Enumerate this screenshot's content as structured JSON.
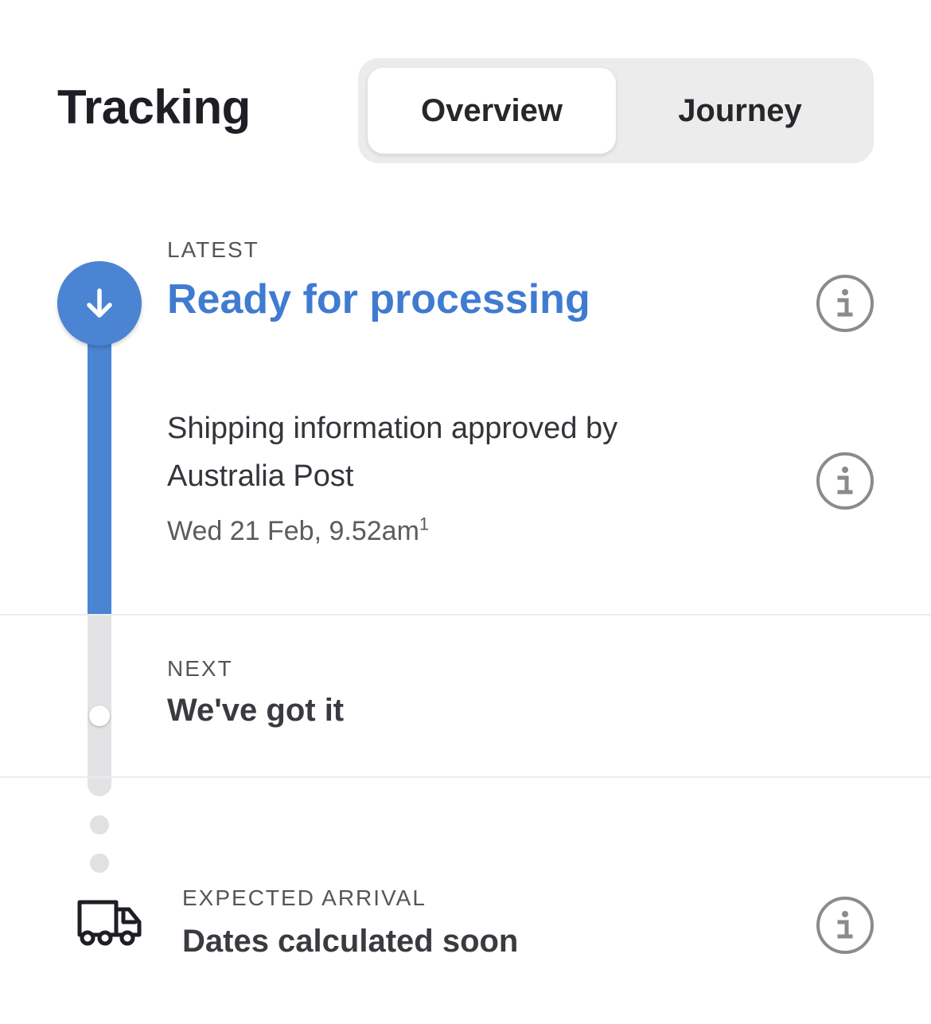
{
  "header": {
    "title": "Tracking",
    "tabs": [
      {
        "label": "Overview",
        "selected": true
      },
      {
        "label": "Journey",
        "selected": false
      }
    ]
  },
  "latest": {
    "label": "LATEST",
    "status": "Ready for processing",
    "icon": "arrow-down-icon",
    "detail": "Shipping information approved by Australia Post",
    "timestamp": "Wed 21 Feb, 9.52am",
    "footnote": "1"
  },
  "next": {
    "label": "NEXT",
    "status": "We've got it"
  },
  "arrival": {
    "label": "EXPECTED ARRIVAL",
    "status": "Dates calculated soon",
    "icon": "truck-icon"
  },
  "colors": {
    "accent": "#4a84d3",
    "accent_text": "#3f7bd0",
    "rail_inactive": "#e3e3e5",
    "info_icon": "#8a8a8f"
  }
}
